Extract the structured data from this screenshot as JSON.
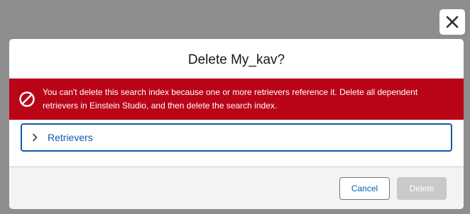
{
  "modal": {
    "title": "Delete My_kav?",
    "error": {
      "message": "You can't delete this search index because one or more retrievers reference it. Delete all dependent retrievers in Einstein Studio, and then delete the search index."
    },
    "accordion": {
      "label": "Retrievers",
      "expanded": false
    },
    "footer": {
      "cancel_label": "Cancel",
      "delete_label": "Delete",
      "delete_disabled": true
    }
  },
  "icons": {
    "close": "close-icon",
    "error": "ban-icon",
    "chevron": "chevron-right-icon"
  },
  "colors": {
    "overlay": "#8e8e8e",
    "error_background": "#ba0517",
    "brand_blue": "#0b5cab",
    "disabled_button": "#c9c9c9",
    "footer_background": "#f3f3f3"
  }
}
